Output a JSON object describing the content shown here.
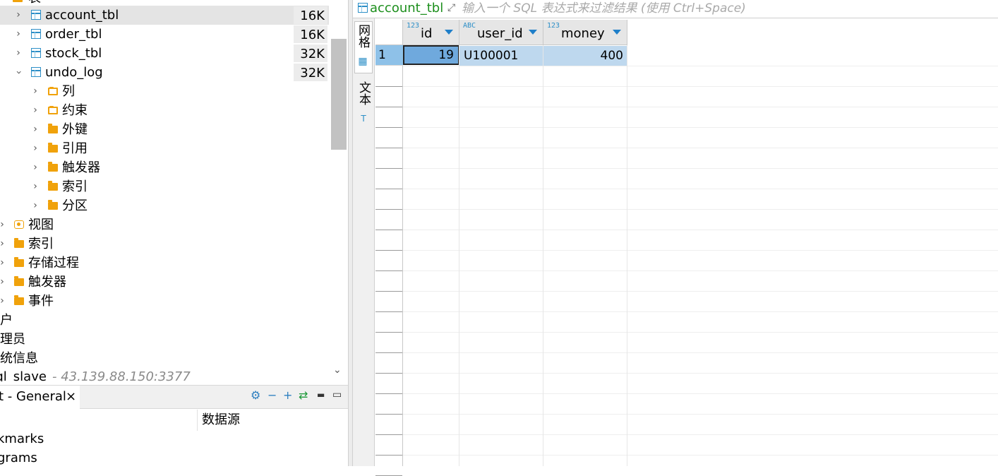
{
  "navigator": {
    "top_cut_label": "表",
    "tables": [
      {
        "name": "account_tbl",
        "size": "16K",
        "selected": true
      },
      {
        "name": "order_tbl",
        "size": "16K"
      },
      {
        "name": "stock_tbl",
        "size": "32K"
      },
      {
        "name": "undo_log",
        "size": "32K"
      }
    ],
    "undo_children": [
      "列",
      "约束",
      "外键",
      "引用",
      "触发器",
      "索引",
      "分区"
    ],
    "schema_folders": [
      "视图",
      "索引",
      "存储过程",
      "触发器",
      "事件"
    ],
    "root_items": [
      "用户",
      "管理员",
      "系统信息"
    ],
    "connection": {
      "name": "sql_slave",
      "address": " - 43.139.88.150:3377"
    }
  },
  "bottom_panel": {
    "tab_label": "t - General",
    "close": "×",
    "column_header": "数据源",
    "rows": [
      "kmarks",
      "grams"
    ]
  },
  "editor": {
    "table_label": "account_tbl",
    "filter_placeholder": "输入一个 SQL 表达式来过滤结果 (使用 Ctrl+Space)",
    "view_tabs": {
      "grid": "网格",
      "text": "文本"
    },
    "columns": [
      {
        "type": "123",
        "name": "id"
      },
      {
        "type": "ABC",
        "name": "user_id"
      },
      {
        "type": "123",
        "name": "money"
      }
    ],
    "rows": [
      {
        "num": "1",
        "id": "19",
        "user_id": "U100001",
        "money": "400"
      }
    ]
  },
  "colors": {
    "accent": "#1f7fc9",
    "folder": "#f0a20b",
    "selection": "#bed8ee",
    "table_label": "#1d8f1d"
  }
}
